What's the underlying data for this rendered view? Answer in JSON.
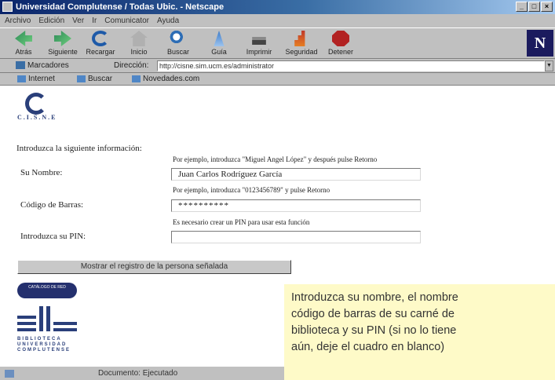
{
  "window": {
    "title": "Universidad Complutense / Todas Ubic. - Netscape",
    "controls": [
      "_",
      "□",
      "×"
    ]
  },
  "menu": [
    "Archivo",
    "Edición",
    "Ver",
    "Ir",
    "Comunicator",
    "Ayuda"
  ],
  "toolbar": {
    "buttons": [
      "Atrás",
      "Siguiente",
      "Recargar",
      "Inicio",
      "Buscar",
      "Guía",
      "Imprimir",
      "Seguridad",
      "Detener"
    ],
    "throbber": "N"
  },
  "location": {
    "bookmarks_label": "Marcadores",
    "label": "Dirección:",
    "url": "http://cisne.sim.ucm.es/administrator"
  },
  "personal": [
    "Internet",
    "Buscar",
    "Novedades.com"
  ],
  "page": {
    "logo_text": "C.I.S.N.E",
    "intro": "Introduzca la siguiente información:",
    "hint_name": "Por ejemplo, introduzca \"Miguel Angel López\" y después pulse Retorno",
    "label_name": "Su Nombre:",
    "value_name": "Juan Carlos Rodríguez García",
    "hint_barcode": "Por ejemplo, introduzca \"0123456789\" y pulse Retorno",
    "label_barcode": "Código de Barras:",
    "value_barcode": "**********",
    "hint_pin": "Es necesario crear un PIN para usar esta función",
    "label_pin": "Introduzca su PIN:",
    "value_pin": "",
    "submit": "Mostrar el registro de la persona señalada",
    "badge": "CATÁLOGO DE RED",
    "library_text": [
      "BIBLIOTECA",
      "UNIVERSIDAD",
      "COMPLUTENSE"
    ]
  },
  "status": "Documento: Ejecutado",
  "callout": [
    "Introduzca su nombre, el nombre",
    "código de barras de su carné de",
    "biblioteca y su PIN (si no lo tiene",
    "aún, deje el cuadro en blanco)"
  ],
  "colors": {
    "title_bar": "#0a246a",
    "chrome": "#c0c0c0",
    "logo": "#2a3f7a",
    "callout_bg": "#fefac8"
  }
}
